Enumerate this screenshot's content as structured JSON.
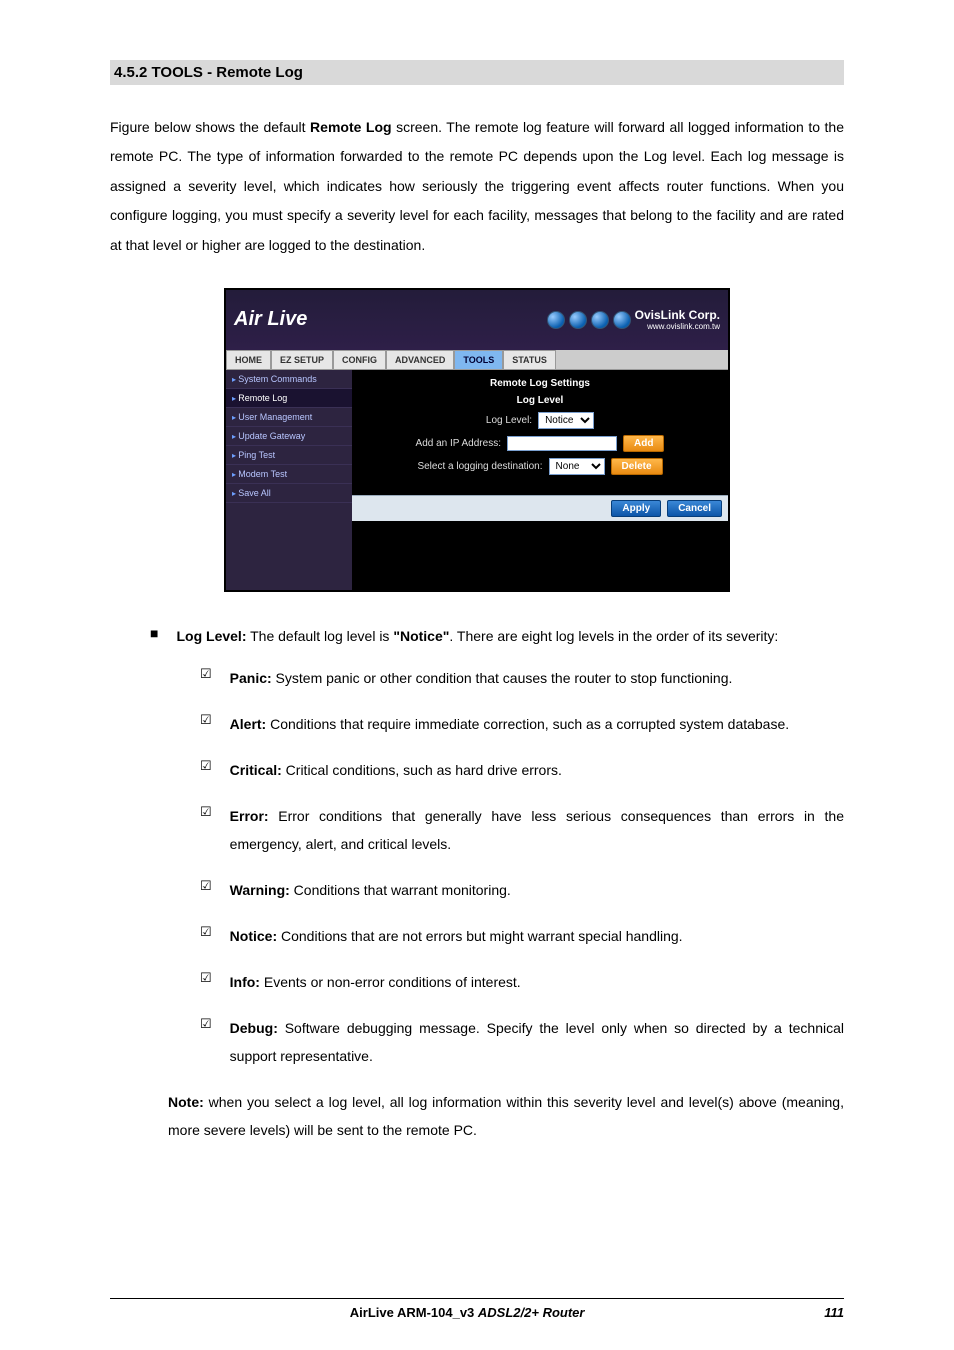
{
  "section_heading": "4.5.2 TOOLS - Remote Log",
  "intro_prefix": "Figure below shows the default ",
  "intro_bold1": "Remote Log",
  "intro_suffix": " screen. The remote log feature will forward all logged information to the remote PC. The type of information forwarded to the remote PC depends upon the Log level. Each log message is assigned a severity level, which indicates how seriously the triggering event affects router functions. When you configure logging, you must specify a severity level for each facility, messages that belong to the facility and are rated at that level or higher are logged to the destination.",
  "screenshot": {
    "logo_text": "Air Live",
    "ovis_title": "OvisLink Corp.",
    "ovis_url": "www.ovislink.com.tw",
    "tabs": [
      "HOME",
      "EZ SETUP",
      "CONFIG",
      "ADVANCED",
      "TOOLS",
      "STATUS"
    ],
    "active_tab_index": 4,
    "sidebar": [
      "System Commands",
      "Remote Log",
      "User Management",
      "Update Gateway",
      "Ping Test",
      "Modem Test",
      "Save All"
    ],
    "active_sidebar_index": 1,
    "panel_title": "Remote Log Settings",
    "log_level_heading": "Log Level",
    "log_level_label": "Log Level:",
    "log_level_value": "Notice",
    "add_ip_label": "Add an IP Address:",
    "add_ip_value": "",
    "add_btn": "Add",
    "dest_label": "Select a logging destination:",
    "dest_value": "None",
    "delete_btn": "Delete",
    "apply_btn": "Apply",
    "cancel_btn": "Cancel"
  },
  "main_bullet_label": "Log Level:",
  "main_bullet_text_1": " The default log level is ",
  "main_bullet_bold": "\"Notice\"",
  "main_bullet_text_2": ". There are eight log levels in the order of its severity:",
  "levels": [
    {
      "name": "Panic:",
      "desc": " System panic or other condition that causes the router to stop functioning."
    },
    {
      "name": "Alert:",
      "desc": " Conditions that require immediate correction, such as a corrupted system database."
    },
    {
      "name": "Critical:",
      "desc": " Critical conditions, such as hard drive errors."
    },
    {
      "name": "Error:",
      "desc": " Error conditions that generally have less serious consequences than errors in the emergency, alert, and critical levels."
    },
    {
      "name": "Warning:",
      "desc": " Conditions that warrant monitoring."
    },
    {
      "name": "Notice:",
      "desc": " Conditions that are not errors but might warrant special handling."
    },
    {
      "name": "Info:",
      "desc": " Events or non-error conditions of interest."
    },
    {
      "name": "Debug:",
      "desc": " Software debugging message. Specify the level only when so directed by a technical support representative."
    }
  ],
  "note_label": "Note:",
  "note_text": " when you select a log level, all log information within this severity level and level(s) above (meaning, more severe levels) will be sent to the remote PC.",
  "footer_center_1": "AirLive ARM-104_v3 ",
  "footer_center_2": "ADSL2/2+ Router",
  "footer_page": "111"
}
